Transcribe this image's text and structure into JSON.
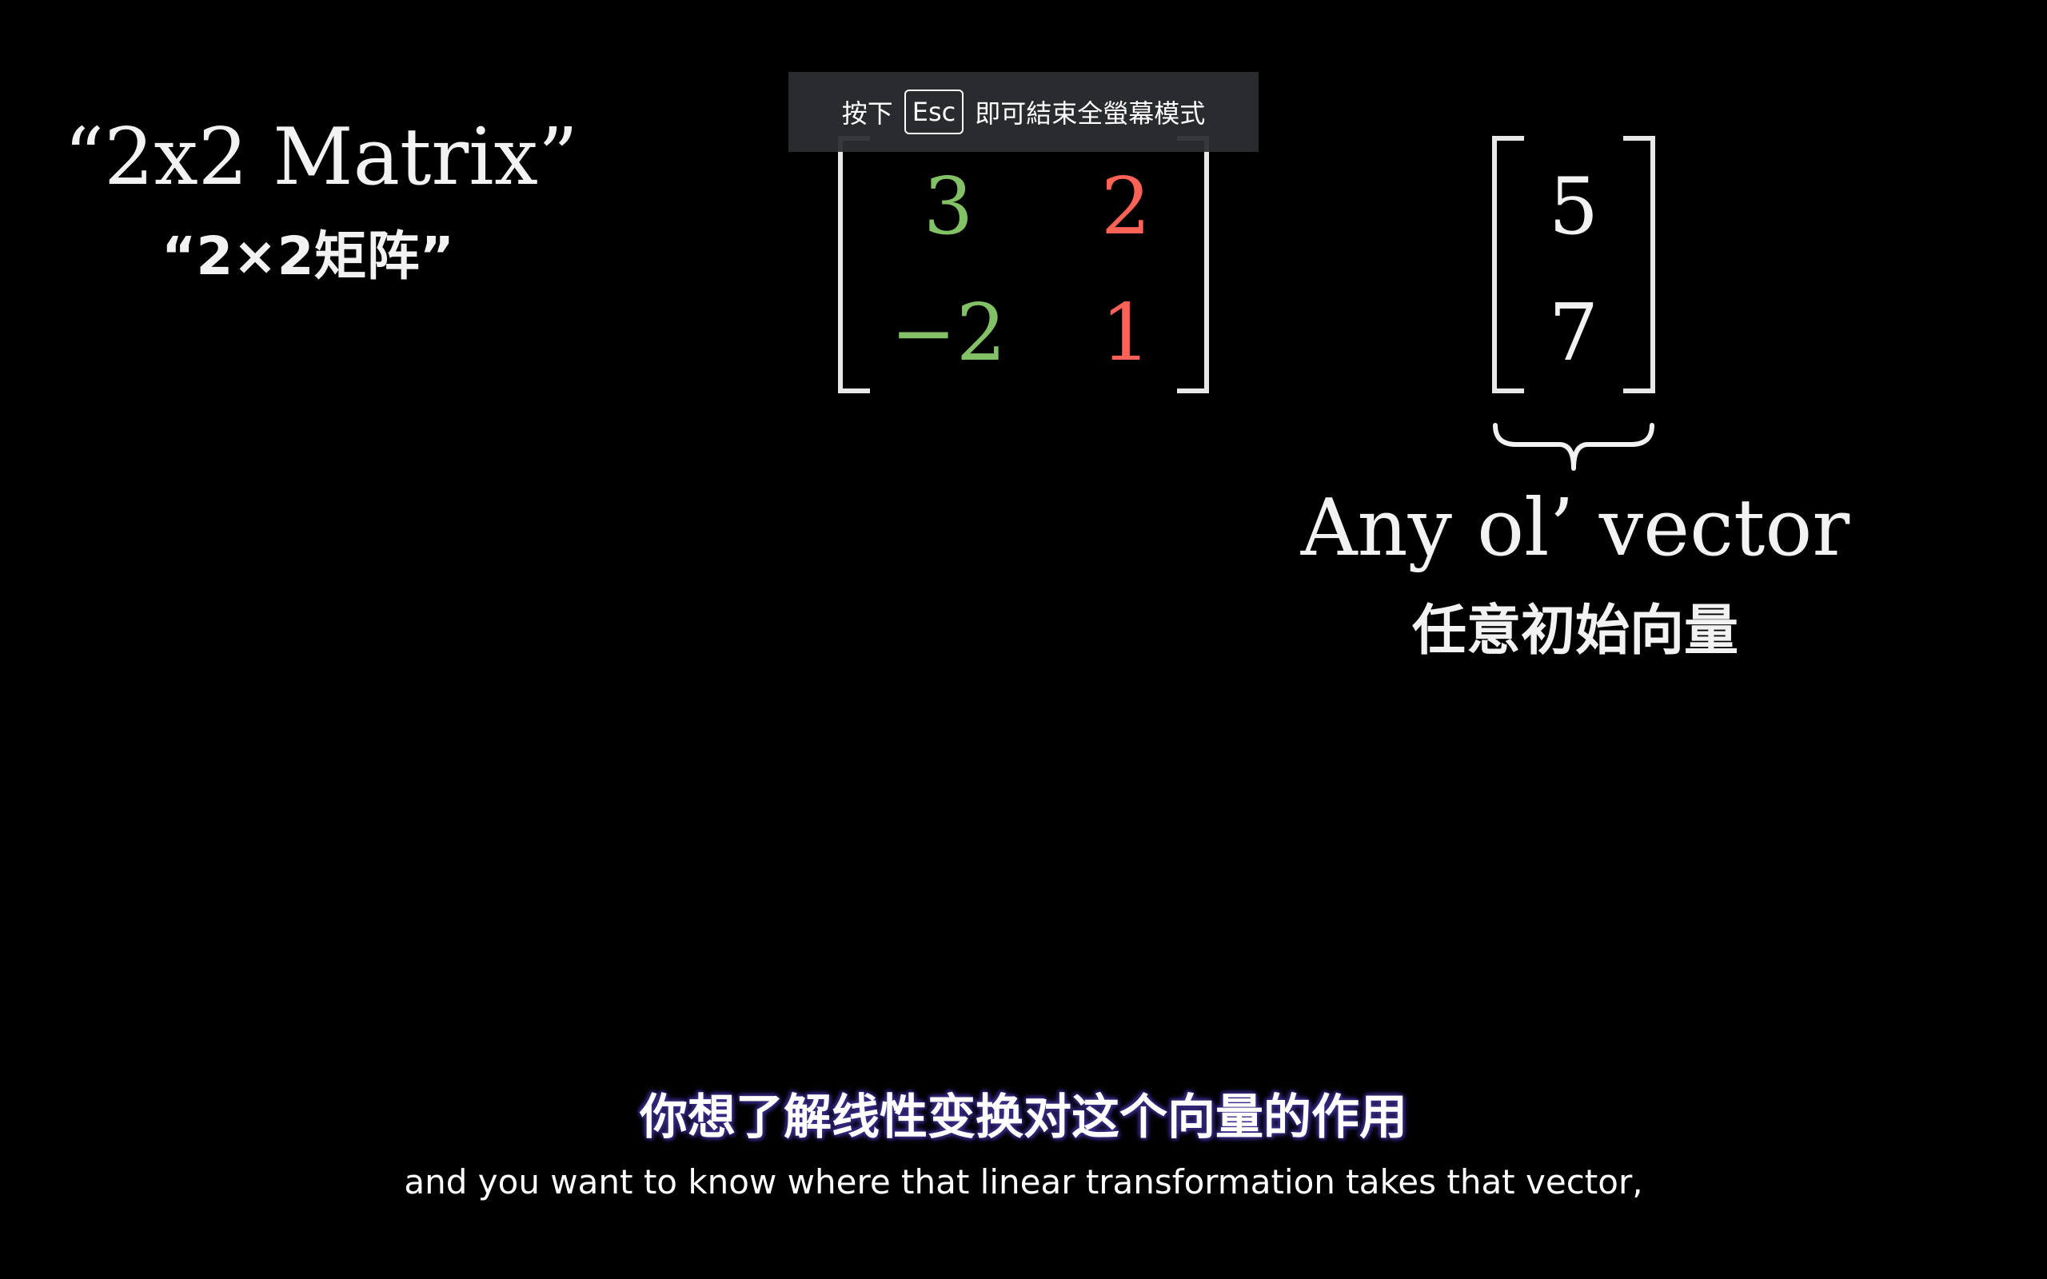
{
  "scene": {
    "matrix_label_en": "“2x2 Matrix”",
    "matrix_label_zh": "“2×2矩阵”",
    "matrix": {
      "cells": [
        {
          "value": "3",
          "color": "#83c167"
        },
        {
          "value": "2",
          "color": "#fc6255"
        },
        {
          "value": "−2",
          "color": "#83c167"
        },
        {
          "value": "1",
          "color": "#fc6255"
        }
      ]
    },
    "vector": {
      "values": [
        "5",
        "7"
      ]
    },
    "vector_label_en": "Any ol’ vector",
    "vector_label_zh": "任意初始向量"
  },
  "fullscreen_toast": {
    "prefix": "按下",
    "key": "Esc",
    "suffix": "即可結束全螢幕模式"
  },
  "subtitles": {
    "zh": "你想了解线性变换对这个向量的作用",
    "en": "and you want to know where that linear transformation takes that vector,"
  },
  "colors": {
    "background": "#000000",
    "green": "#83c167",
    "red": "#fc6255",
    "toast_bg": "#2c2e32"
  }
}
